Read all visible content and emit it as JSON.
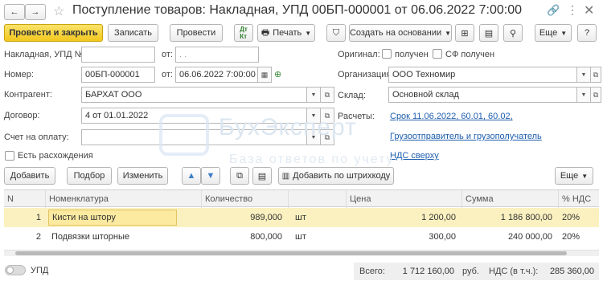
{
  "window": {
    "title": "Поступление товаров: Накладная, УПД 00БП-000001 от 06.06.2022 7:00:00"
  },
  "toolbar": {
    "post_close": "Провести и закрыть",
    "save": "Записать",
    "post": "Провести",
    "print": "Печать",
    "create_based": "Создать на основании",
    "more": "Еще"
  },
  "form": {
    "invoice_label": "Накладная, УПД №:",
    "invoice_number": "",
    "from_label": "от:",
    "invoice_date": ". .",
    "number_label": "Номер:",
    "number_value": "00БП-000001",
    "date_value": "06.06.2022  7:00:00",
    "counterparty_label": "Контрагент:",
    "counterparty_value": "БАРХАТ ООО",
    "contract_label": "Договор:",
    "contract_value": "4 от 01.01.2022",
    "payment_label": "Счет на оплату:",
    "payment_value": "",
    "discrepancy_label": "Есть расхождения",
    "original_label": "Оригинал:",
    "received_label": "получен",
    "sf_received_label": "СФ получен",
    "org_label": "Организация:",
    "org_value": "ООО Техномир",
    "warehouse_label": "Склад:",
    "warehouse_value": "Основной склад",
    "settlements_label": "Расчеты:",
    "settlements_link": "Срок 11.06.2022, 60.01, 60.02,",
    "shipper_link": "Грузоотправитель и грузополучатель",
    "vat_link": "НДС сверху"
  },
  "table_toolbar": {
    "add": "Добавить",
    "select": "Подбор",
    "change": "Изменить",
    "barcode": "Добавить по штрихкоду",
    "more": "Еще"
  },
  "table": {
    "columns": [
      "N",
      "Номенклатура",
      "Количество",
      "",
      "Цена",
      "Сумма",
      "% НДС"
    ],
    "rows": [
      {
        "n": "1",
        "name": "Кисти на штору",
        "qty": "989,000",
        "unit": "шт",
        "price": "1 200,00",
        "sum": "1 186 800,00",
        "vat": "20%"
      },
      {
        "n": "2",
        "name": "Подвязки шторные",
        "qty": "800,000",
        "unit": "шт",
        "price": "300,00",
        "sum": "240 000,00",
        "vat": "20%"
      }
    ]
  },
  "footer": {
    "upd_label": "УПД",
    "total_label": "Всего:",
    "total_value": "1 712 160,00",
    "currency": "руб.",
    "vat_label": "НДС (в т.ч.):",
    "vat_value": "285 360,00"
  },
  "watermark": {
    "line1": "БухЭксперт",
    "line2": "База ответов по учету"
  },
  "colors": {
    "primary": "#f2c81e",
    "selected_row": "#fbf1c0",
    "link": "#1f5fae"
  }
}
